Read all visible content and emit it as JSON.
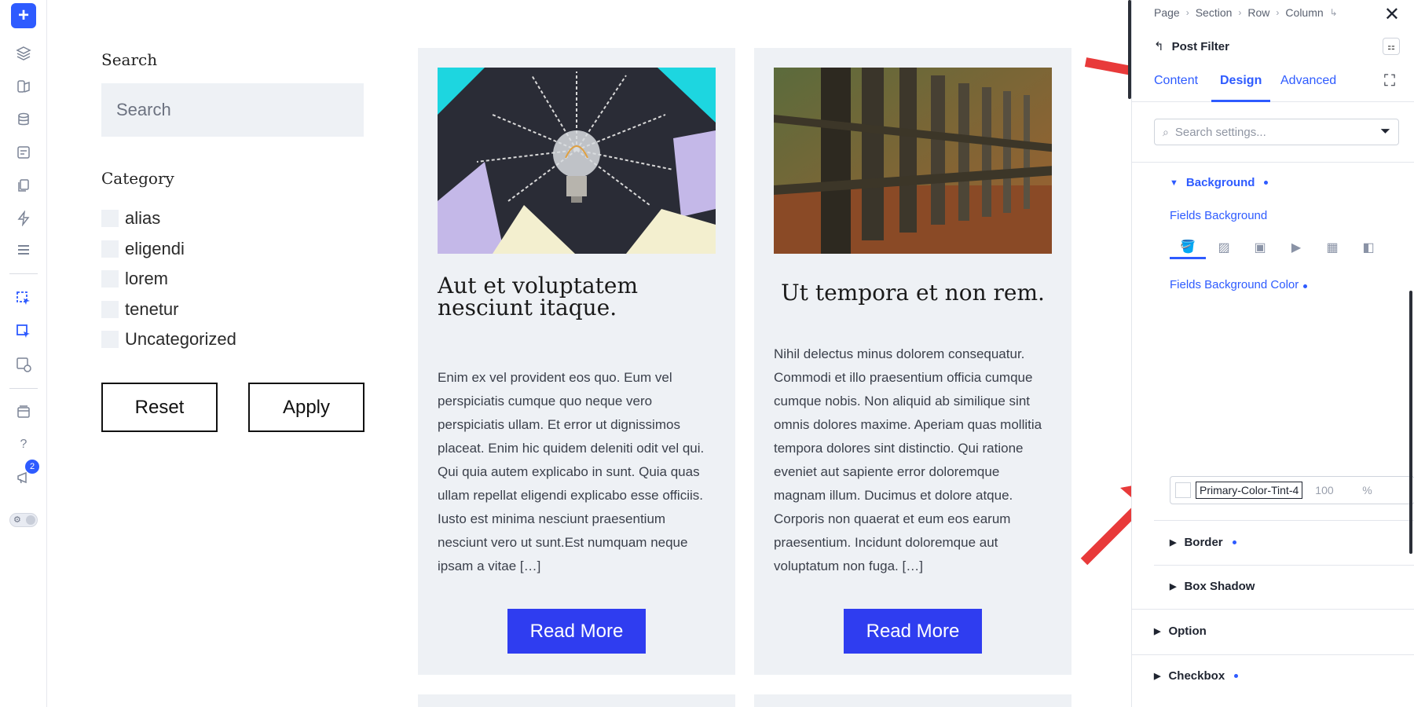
{
  "toolbar": {
    "add_label": "+",
    "badge_count": "2",
    "help_label": "?"
  },
  "filter": {
    "search_title": "Search",
    "search_placeholder": "Search",
    "category_title": "Category",
    "categories": [
      "alias",
      "eligendi",
      "lorem",
      "tenetur",
      "Uncategorized"
    ],
    "reset_label": "Reset",
    "apply_label": "Apply"
  },
  "posts": [
    {
      "title": "Aut et voluptatem nesciunt itaque.",
      "excerpt": "Enim ex vel provident eos quo. Eum vel perspiciatis cumque quo neque vero perspiciatis ullam. Et error ut dignissimos placeat. Enim hic quidem deleniti odit vel qui. Qui quia autem explicabo in sunt. Quia quas ullam repellat eligendi explicabo esse officiis. Iusto est minima nesciunt praesentium nesciunt vero ut sunt.Est numquam neque ipsam a vitae […]",
      "read_more": "Read More"
    },
    {
      "title": "Ut tempora et non rem.",
      "excerpt": "Nihil delectus minus dolorem consequatur. Commodi et illo praesentium officia cumque cumque nobis. Non aliquid ab similique sint omnis dolores maxime. Aperiam quas mollitia tempora dolores sint distinctio. Qui ratione eveniet aut sapiente error doloremque magnam illum. Ducimus et dolore atque. Corporis non quaerat et eum eos earum praesentium. Incidunt doloremque aut voluptatum non fuga. […]",
      "read_more": "Read More"
    }
  ],
  "panel": {
    "breadcrumbs": [
      "Page",
      "Section",
      "Row",
      "Column"
    ],
    "module_name": "Post Filter",
    "tabs": [
      "Content",
      "Design",
      "Advanced"
    ],
    "active_tab": "Design",
    "search_placeholder": "Search settings...",
    "background_section": "Background",
    "fields_background": "Fields Background",
    "fields_background_color": "Fields Background Color",
    "color_name": "Primary-Color-Tint-4",
    "opacity_value": "100",
    "opacity_unit": "%",
    "border_section": "Border",
    "box_shadow_section": "Box Shadow",
    "option_section": "Option",
    "checkbox_section": "Checkbox"
  },
  "colors": {
    "accent": "#2e5bff",
    "read_more_bg": "#2f3df0",
    "card_bg": "#eef1f5",
    "annotation_arrow": "#e83a3a"
  }
}
